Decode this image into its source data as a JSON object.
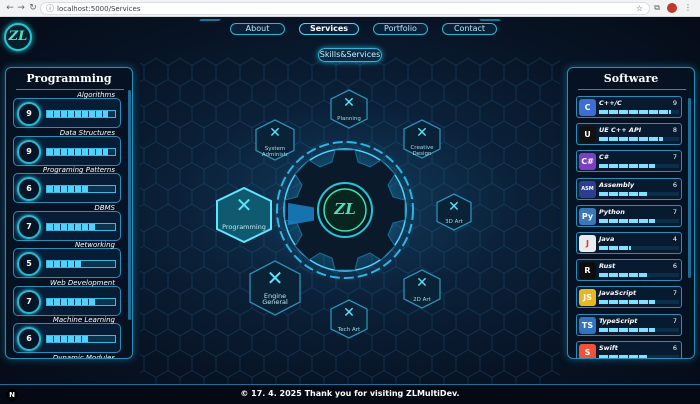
{
  "browser": {
    "url": "localhost:5000/Services"
  },
  "nav": {
    "about": "About",
    "services": "Services",
    "portfolio": "Portfolio",
    "contact": "Contact"
  },
  "logo": "ZL",
  "section_title": "Skills&Services",
  "programming": {
    "title": "Programming",
    "items": [
      {
        "name": "Algorithms",
        "level": "9",
        "fill": 0.9
      },
      {
        "name": "Data Structures",
        "level": "9",
        "fill": 0.9
      },
      {
        "name": "Programing Patterns",
        "level": "6",
        "fill": 0.6
      },
      {
        "name": "DBMS",
        "level": "7",
        "fill": 0.7
      },
      {
        "name": "Networking",
        "level": "5",
        "fill": 0.5
      },
      {
        "name": "Web Development",
        "level": "7",
        "fill": 0.7
      },
      {
        "name": "Machine Learning",
        "level": "6",
        "fill": 0.6
      },
      {
        "name": "Dynamic Modules",
        "level": "",
        "fill": 0.0
      }
    ]
  },
  "software": {
    "title": "Software",
    "items": [
      {
        "name": "C++/C",
        "level": "9",
        "fill": 0.9,
        "icon": "C",
        "color": "#3c6fd6"
      },
      {
        "name": "UE C++ API",
        "level": "8",
        "fill": 0.8,
        "icon": "U",
        "color": "#111111"
      },
      {
        "name": "C#",
        "level": "7",
        "fill": 0.7,
        "icon": "C#",
        "color": "#7b3fc4"
      },
      {
        "name": "Assembly",
        "level": "6",
        "fill": 0.6,
        "icon": "ASM",
        "color": "#2a3f8f"
      },
      {
        "name": "Python",
        "level": "7",
        "fill": 0.7,
        "icon": "Py",
        "color": "#3b78b8"
      },
      {
        "name": "Java",
        "level": "4",
        "fill": 0.4,
        "icon": "J",
        "color": "#e9ecef"
      },
      {
        "name": "Rust",
        "level": "6",
        "fill": 0.6,
        "icon": "R",
        "color": "#0d0d0d"
      },
      {
        "name": "JavaScript",
        "level": "7",
        "fill": 0.7,
        "icon": "JS",
        "color": "#e7b81f"
      },
      {
        "name": "TypeScript",
        "level": "7",
        "fill": 0.7,
        "icon": "TS",
        "color": "#2f74c0"
      },
      {
        "name": "Swift",
        "level": "6",
        "fill": 0.6,
        "icon": "S",
        "color": "#f05138"
      }
    ]
  },
  "services": {
    "planning": "Planning",
    "creative": "Creative Design",
    "art3d": "3D Art",
    "art2d": "2D Art",
    "tech": "Tech Art",
    "engine": "Engine General",
    "programming": "Programming",
    "sysadmin": "System Administr"
  },
  "footer": {
    "text": "© 17. 4. 2025 Thank you for visiting ZLMultiDev.",
    "badge": "N"
  }
}
